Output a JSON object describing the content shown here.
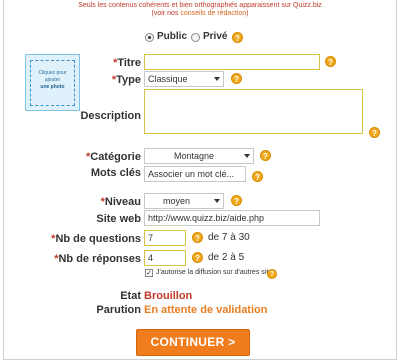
{
  "notice": {
    "line1": "Seuls les contenus cohérents et bien orthographiés apparaissent sur Quizz.biz",
    "line2_prefix": "(voir nos ",
    "line2_link": "conseils de rédaction",
    "line2_suffix": ")"
  },
  "photo": {
    "line1": "Cliquez pour",
    "line2": "ajouter",
    "line3": "une photo"
  },
  "visibility": {
    "public_label": "Public",
    "private_label": "Privé",
    "selected": "Public"
  },
  "help_glyph": "?",
  "form": {
    "titre": {
      "label": "Titre",
      "value": ""
    },
    "type": {
      "label": "Type",
      "value": "Classique"
    },
    "description": {
      "label": "Description",
      "value": ""
    },
    "categorie": {
      "label": "Catégorie",
      "value": "Montagne"
    },
    "mots_cles": {
      "label": "Mots clés",
      "placeholder": "Associer un mot clé..."
    },
    "niveau": {
      "label": "Niveau",
      "value": "moyen"
    },
    "site_web": {
      "label": "Site web",
      "value": "http://www.quizz.biz/aide.php"
    },
    "nb_questions": {
      "label": "Nb de questions",
      "value": "7",
      "range": "de 7 à 30"
    },
    "nb_reponses": {
      "label": "Nb de réponses",
      "value": "4",
      "range": "de 2 à 5"
    },
    "autorise": {
      "label": "J'autorise la diffusion sur d'autres sites",
      "checked": true
    },
    "etat": {
      "label": "Etat",
      "value": "Brouillon"
    },
    "parution": {
      "label": "Parution",
      "value": "En attente de validation"
    }
  },
  "required_mark": "*",
  "continue_button": "CONTINUER >",
  "colors": {
    "accent_orange": "#f07c1e",
    "required_red": "#c0392b",
    "status_red": "#c0392b",
    "parution_orange": "#e67e22",
    "field_border": "#d8c24a"
  }
}
